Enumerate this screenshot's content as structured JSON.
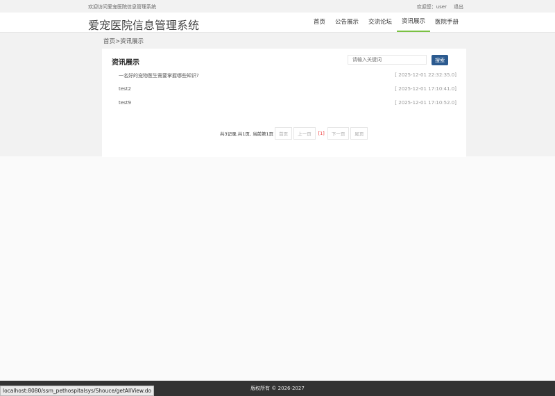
{
  "topbar": {
    "welcome": "欢迎访问爱宠医院信息管理系统",
    "user_greeting": "欢迎您：user",
    "logout": "退出"
  },
  "header": {
    "logo": "爱宠医院信息管理系统",
    "nav": [
      "首页",
      "公告展示",
      "交流论坛",
      "资讯展示",
      "医院手册"
    ],
    "active": 3
  },
  "breadcrumb": "首页>资讯展示",
  "main": {
    "title": "资讯展示",
    "search_placeholder": "请输入关键词",
    "search_label": "搜索",
    "items": [
      {
        "title": "一名好的宠物医生需要掌握哪些知识?",
        "date": "[ 2025-12-01 22:32:35.0]"
      },
      {
        "title": "test2",
        "date": "[ 2025-12-01 17:10:41.0]"
      },
      {
        "title": "test9",
        "date": "[ 2025-12-01 17:10:52.0]"
      }
    ],
    "pager": {
      "summary": "共3记录,共1页, 当前第1页",
      "first": "首页",
      "prev": "上一页",
      "current": "[1]",
      "next": "下一页",
      "last": "尾页"
    }
  },
  "footer": "版权所有 © 2026-2027",
  "status_url": "localhost:8080/ssm_pethospitalsys/Shouce/getAllView.do"
}
